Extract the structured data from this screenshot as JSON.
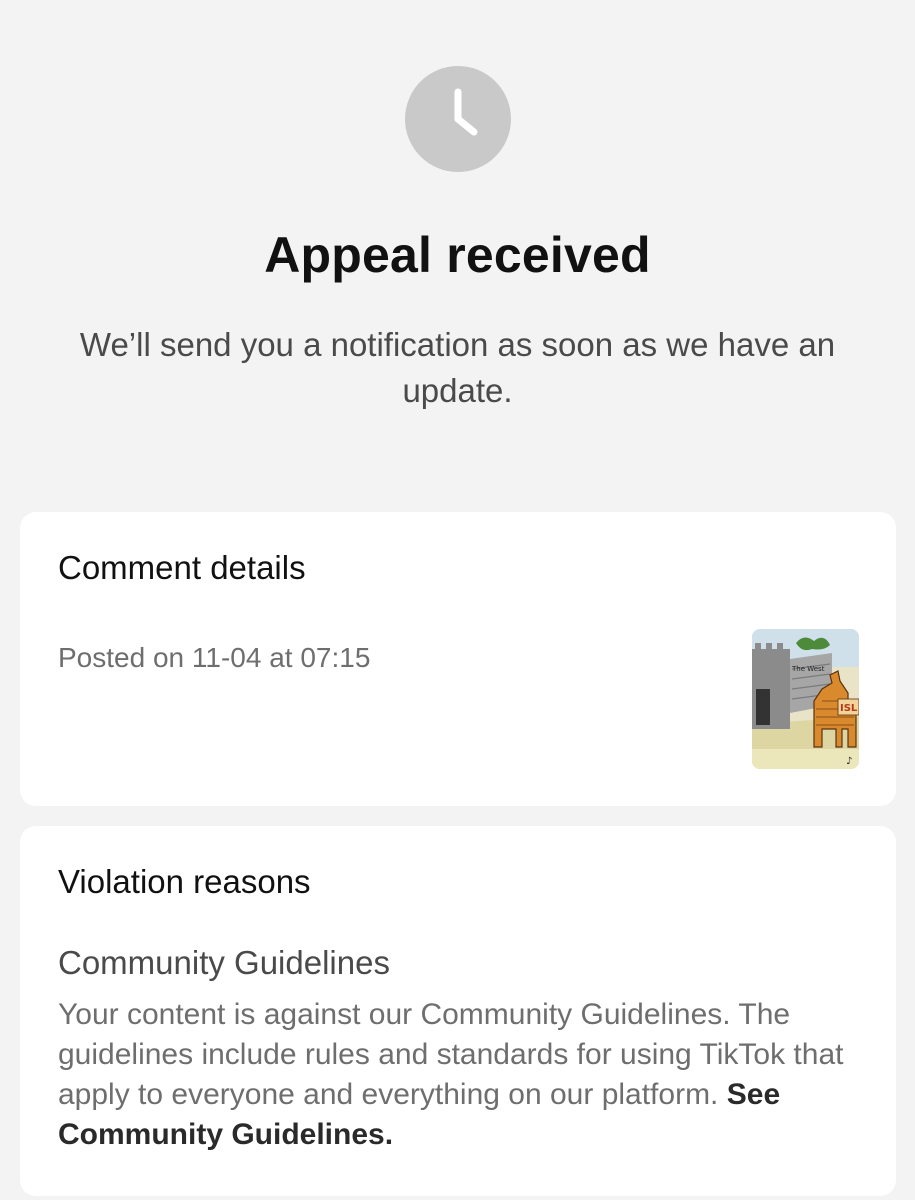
{
  "status": {
    "icon": "clock-icon",
    "title": "Appeal received",
    "subtitle": "We’ll send you a notification as soon as we have an update."
  },
  "comment_details": {
    "heading": "Comment details",
    "posted": "Posted on 11-04 at 07:15",
    "thumbnail_text": "The West"
  },
  "violation": {
    "heading": "Violation reasons",
    "category": "Community Guidelines",
    "description": "Your content is against our Community Guidelines. The guidelines include rules and standards for using TikTok that apply to everyone and everything on our platform.",
    "link_label": "See Community Guidelines."
  }
}
